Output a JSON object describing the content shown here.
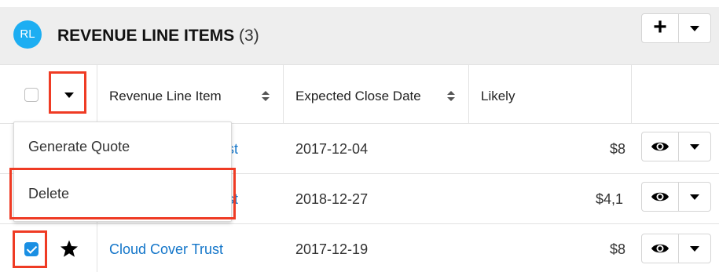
{
  "header": {
    "badge": "RL",
    "title": "REVENUE LINE ITEMS",
    "count": "(3)",
    "add_label": "+"
  },
  "columns": {
    "name": "Revenue Line Item",
    "close_date": "Expected Close Date",
    "likely": "Likely"
  },
  "rows": [
    {
      "name": "st",
      "close_date": "2017-12-04",
      "likely": "$8",
      "checked": false
    },
    {
      "name": "st",
      "close_date": "2018-12-27",
      "likely": "$4,1",
      "checked": false
    },
    {
      "name": "Cloud Cover Trust",
      "close_date": "2017-12-19",
      "likely": "$8",
      "checked": true
    }
  ],
  "mass_actions_menu": {
    "items": [
      "Generate Quote",
      "Delete"
    ]
  },
  "colors": {
    "badge": "#1daef2",
    "link": "#1275c9",
    "highlight": "#ef3b24",
    "checkbox_checked": "#1a8fe3"
  },
  "icons": [
    "plus-icon",
    "caret-down-icon",
    "sort-icon",
    "eye-icon",
    "star-icon",
    "checkbox"
  ]
}
